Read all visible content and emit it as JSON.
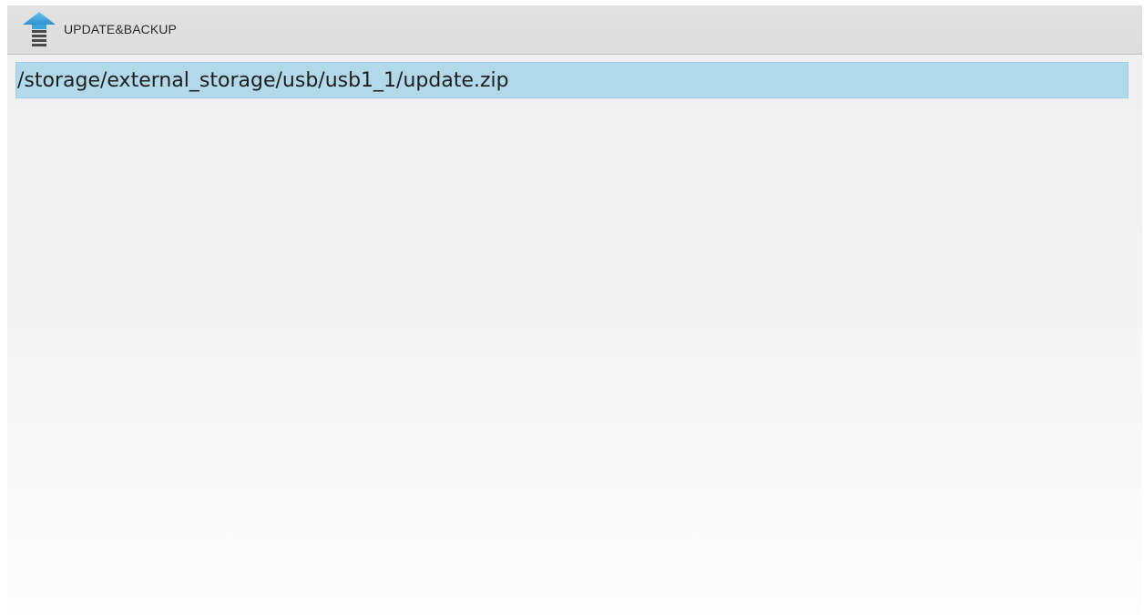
{
  "app": {
    "title": "UPDATE&BACKUP",
    "icon": "upload-arrow-icon"
  },
  "file_list": {
    "items": [
      {
        "path": "/storage/external_storage/usb/usb1_1/update.zip",
        "selected": true
      }
    ]
  },
  "colors": {
    "action_bar": "#dedede",
    "selection": "#b1d9ea",
    "icon_arrow": "#3aa2dc",
    "icon_base": "#4a4a4a"
  }
}
